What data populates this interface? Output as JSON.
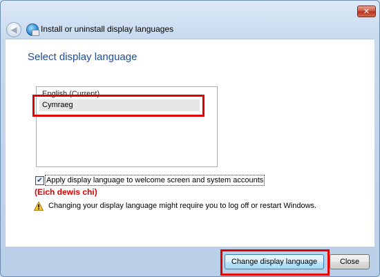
{
  "window": {
    "close_glyph": "✕"
  },
  "navbar": {
    "back_glyph": "◀",
    "title": "Install or uninstall display languages",
    "icon": "globe-keyboard-icon"
  },
  "main": {
    "heading": "Select display language",
    "languages": [
      "English (Current)",
      "Cymraeg"
    ],
    "selected_index": 1,
    "checkbox": {
      "checked": true,
      "glyph": "✔",
      "label": "Apply display language to welcome screen and system accounts"
    },
    "note": "(Eich dewis chi)",
    "warning": {
      "icon": "warning-icon",
      "text": "Changing your display language might require you to log off or restart Windows."
    }
  },
  "footer": {
    "change_label": "Change display language",
    "close_label": "Close"
  },
  "colors": {
    "heading": "#1e4c9a",
    "annotation_red": "#e00000"
  }
}
